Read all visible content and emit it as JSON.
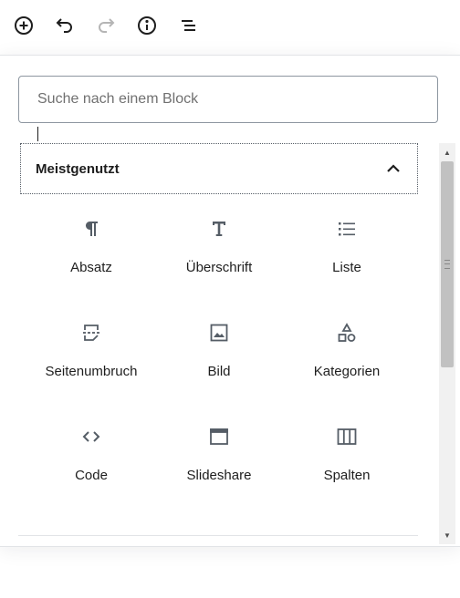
{
  "toolbar": {
    "buttons": [
      {
        "name": "add-block",
        "icon": "plus-circle-icon"
      },
      {
        "name": "undo",
        "icon": "undo-icon"
      },
      {
        "name": "redo",
        "icon": "redo-icon",
        "disabled": true
      },
      {
        "name": "info",
        "icon": "info-icon"
      },
      {
        "name": "outline",
        "icon": "list-outline-icon"
      }
    ]
  },
  "inserter": {
    "search": {
      "placeholder": "Suche nach einem Block",
      "value": ""
    },
    "panel": {
      "title": "Meistgenutzt",
      "expanded": true
    },
    "blocks": [
      {
        "label": "Absatz",
        "icon": "paragraph-icon"
      },
      {
        "label": "Überschrift",
        "icon": "heading-icon"
      },
      {
        "label": "Liste",
        "icon": "list-icon"
      },
      {
        "label": "Seitenumbruch",
        "icon": "page-break-icon"
      },
      {
        "label": "Bild",
        "icon": "image-icon"
      },
      {
        "label": "Kategorien",
        "icon": "categories-icon"
      },
      {
        "label": "Code",
        "icon": "code-icon"
      },
      {
        "label": "Slideshare",
        "icon": "embed-window-icon"
      },
      {
        "label": "Spalten",
        "icon": "columns-icon"
      }
    ]
  },
  "colors": {
    "icon": "#555d66",
    "text": "#1e1e1e",
    "border": "#8d96a0"
  }
}
